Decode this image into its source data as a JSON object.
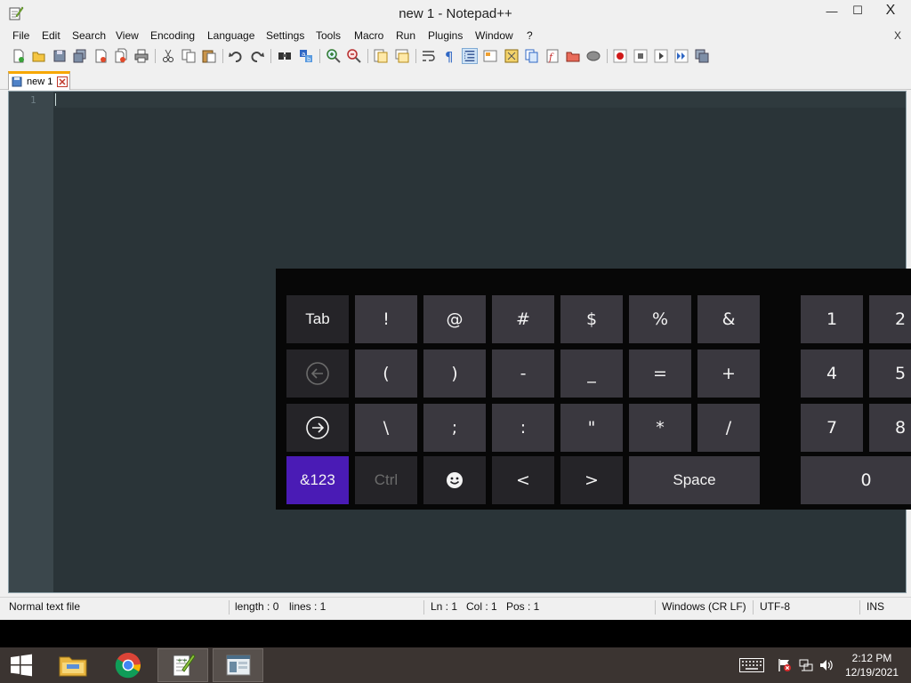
{
  "window": {
    "title": "new 1 - Notepad++",
    "controls": {
      "minimize": "—",
      "maximize": "☐",
      "close": "X"
    }
  },
  "menu": {
    "items": [
      "File",
      "Edit",
      "Search",
      "View",
      "Encoding",
      "Language",
      "Settings",
      "Tools",
      "Macro",
      "Run",
      "Plugins",
      "Window",
      "?"
    ],
    "close_doc": "X"
  },
  "tabs": [
    {
      "label": "new 1",
      "active": true
    }
  ],
  "editor": {
    "line_numbers": [
      "1"
    ],
    "content": "",
    "background": "#2a3438",
    "gutter": "#3b474c"
  },
  "keyboard": {
    "accent_color": "#4a1bb5",
    "rows": [
      [
        "Tab",
        "!",
        "@",
        "#",
        "$",
        "%",
        "&"
      ],
      [
        "backspace-icon",
        "(",
        ")",
        "-",
        "_",
        "=",
        "+"
      ],
      [
        "enter-icon",
        "\\",
        ";",
        ":",
        "\"",
        "*",
        "/"
      ],
      [
        "&123",
        "Ctrl",
        "emoji-icon",
        "<",
        ">",
        "Space"
      ]
    ],
    "numpad": [
      [
        "1",
        "2"
      ],
      [
        "4",
        "5"
      ],
      [
        "7",
        "8"
      ],
      [
        "0"
      ]
    ]
  },
  "statusbar": {
    "file_type": "Normal text file",
    "length": "length : 0",
    "lines": "lines : 1",
    "ln": "Ln : 1",
    "col": "Col : 1",
    "pos": "Pos : 1",
    "eol": "Windows (CR LF)",
    "encoding": "UTF-8",
    "mode": "INS"
  },
  "taskbar": {
    "apps": [
      "start-icon",
      "file-explorer-icon",
      "chrome-icon",
      "notepad-plus-plus-icon",
      "touch-keyboard-app-icon"
    ],
    "tray_icons": [
      "keyboard-icon",
      "action-center-flag-icon",
      "network-icon",
      "volume-icon"
    ],
    "time": "2:12 PM",
    "date": "12/19/2021"
  }
}
